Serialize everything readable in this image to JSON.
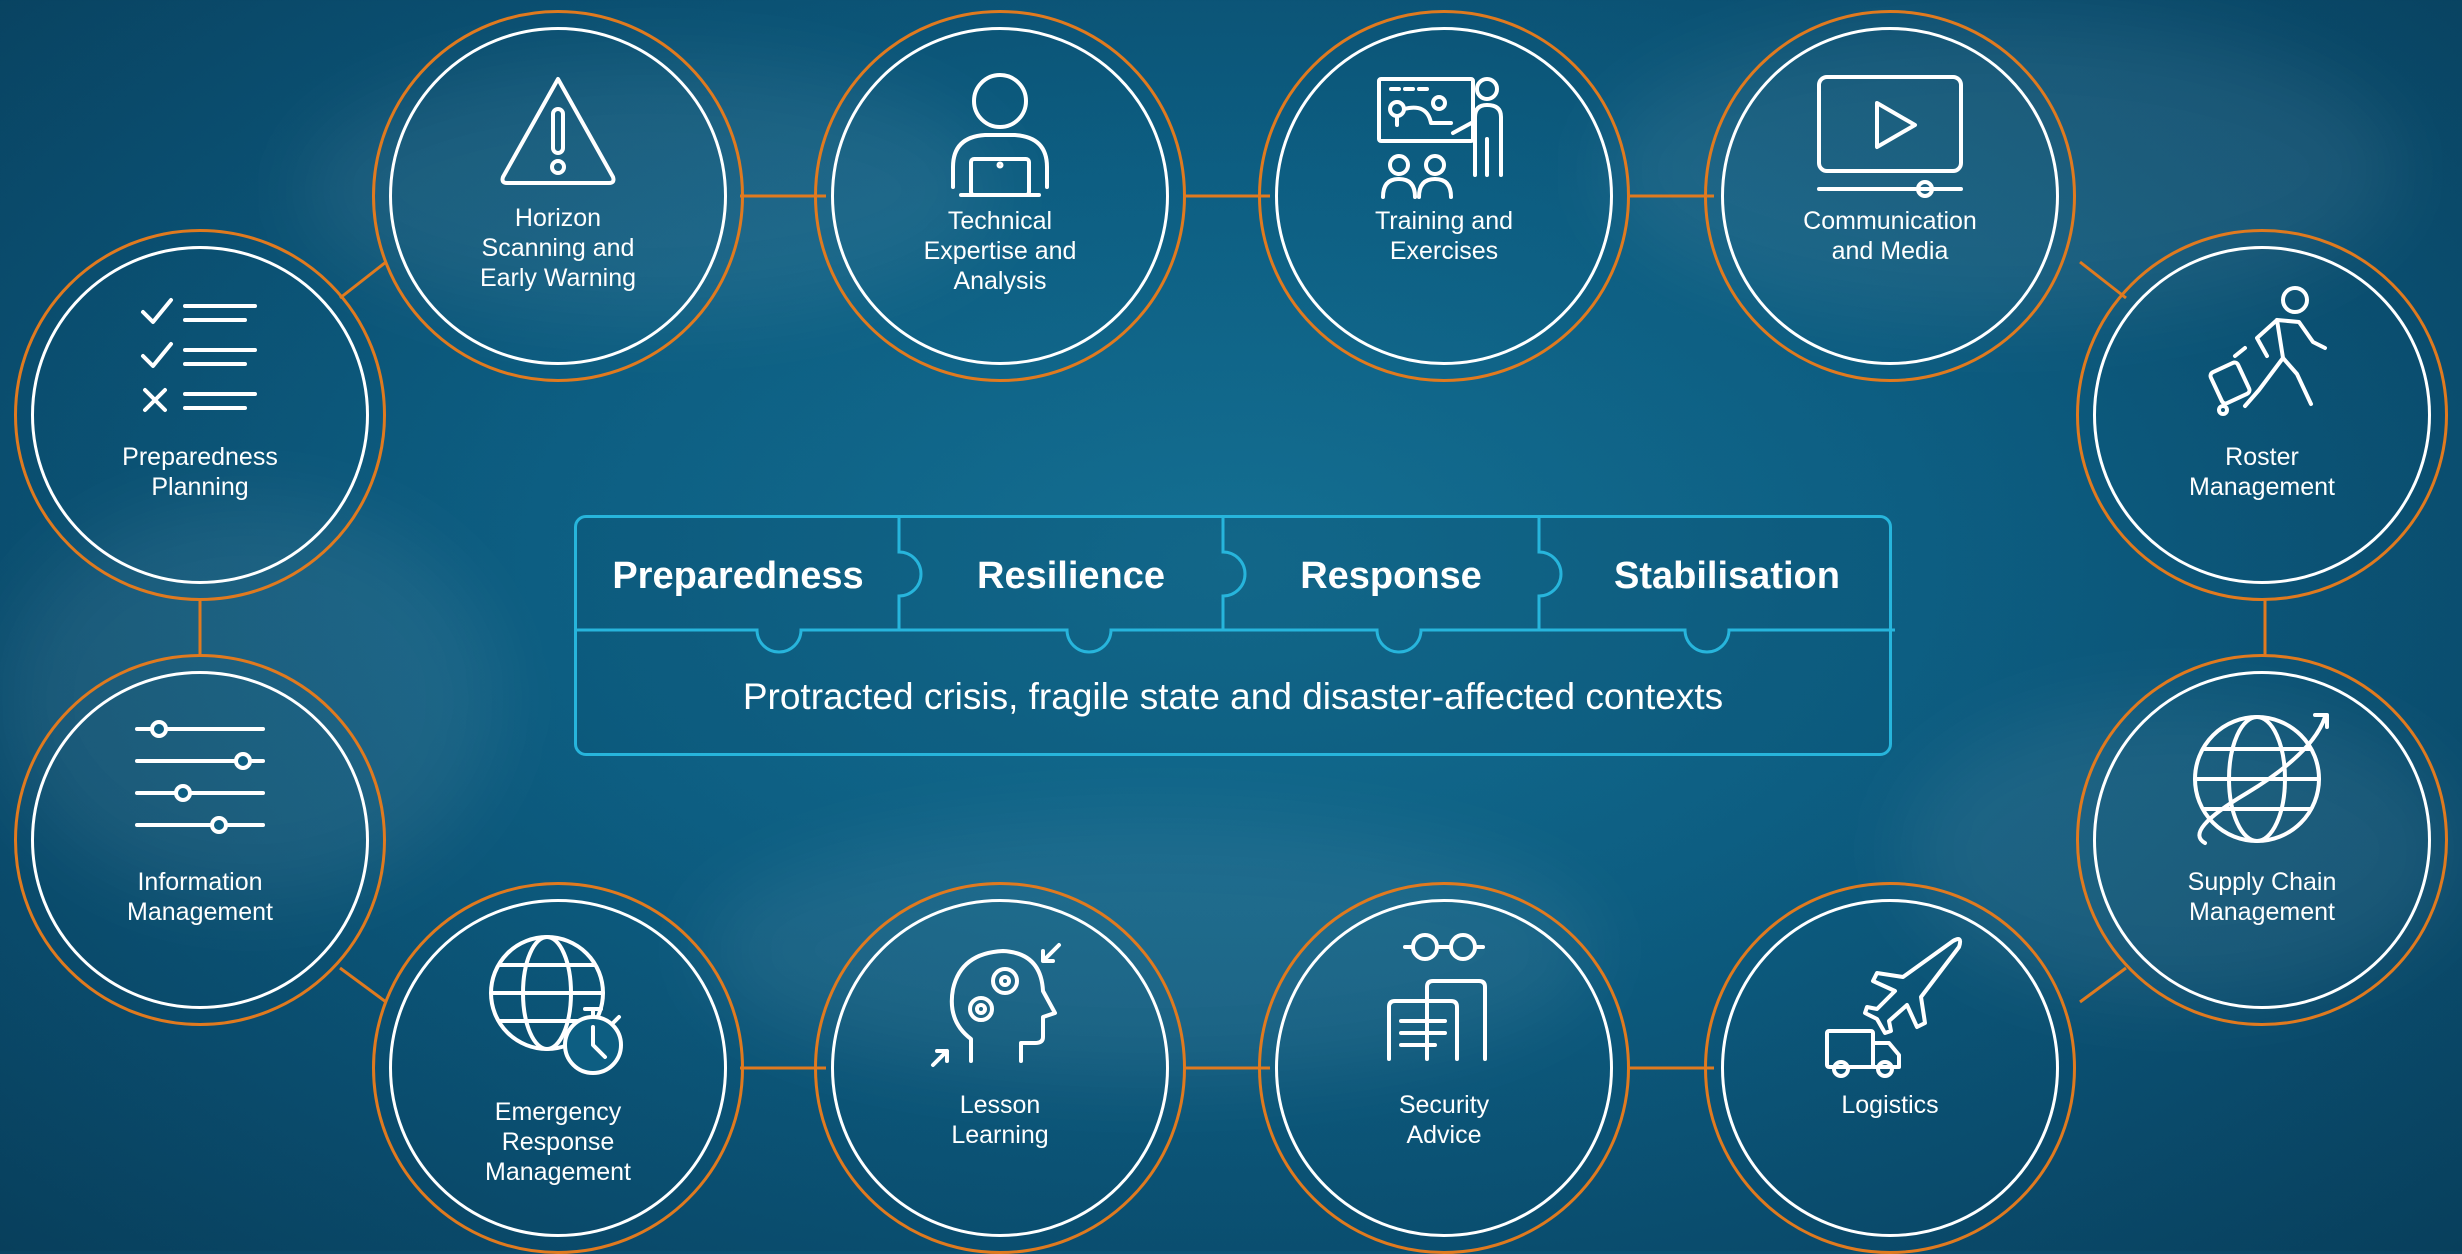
{
  "center": {
    "phases": [
      "Preparedness",
      "Resilience",
      "Response",
      "Stabilisation"
    ],
    "context": "Protracted crisis, fragile state and disaster-affected contexts"
  },
  "services": [
    {
      "name": "horizon-scanning",
      "label": "Horizon\nScanning and\nEarly Warning",
      "icon": "warning-icon"
    },
    {
      "name": "technical-expertise",
      "label": "Technical\nExpertise and\nAnalysis",
      "icon": "laptop-user-icon"
    },
    {
      "name": "training-exercises",
      "label": "Training and\nExercises",
      "icon": "presentation-icon"
    },
    {
      "name": "communication-media",
      "label": "Communication\nand Media",
      "icon": "video-player-icon"
    },
    {
      "name": "roster-management",
      "label": "Roster\nManagement",
      "icon": "traveler-icon"
    },
    {
      "name": "supply-chain-management",
      "label": "Supply Chain\nManagement",
      "icon": "globe-arrow-icon"
    },
    {
      "name": "logistics",
      "label": "Logistics",
      "icon": "plane-truck-icon"
    },
    {
      "name": "security-advice",
      "label": "Security\nAdvice",
      "icon": "documents-glasses-icon"
    },
    {
      "name": "lesson-learning",
      "label": "Lesson\nLearning",
      "icon": "head-gears-icon"
    },
    {
      "name": "emergency-response-management",
      "label": "Emergency\nResponse\nManagement",
      "icon": "globe-stopwatch-icon"
    },
    {
      "name": "information-management",
      "label": "Information\nManagement",
      "icon": "sliders-icon"
    },
    {
      "name": "preparedness-planning",
      "label": "Preparedness\nPlanning",
      "icon": "checklist-icon"
    }
  ],
  "colors": {
    "ring": "#e07a1f",
    "inner": "#ffffff",
    "accent": "#27b5dc"
  }
}
